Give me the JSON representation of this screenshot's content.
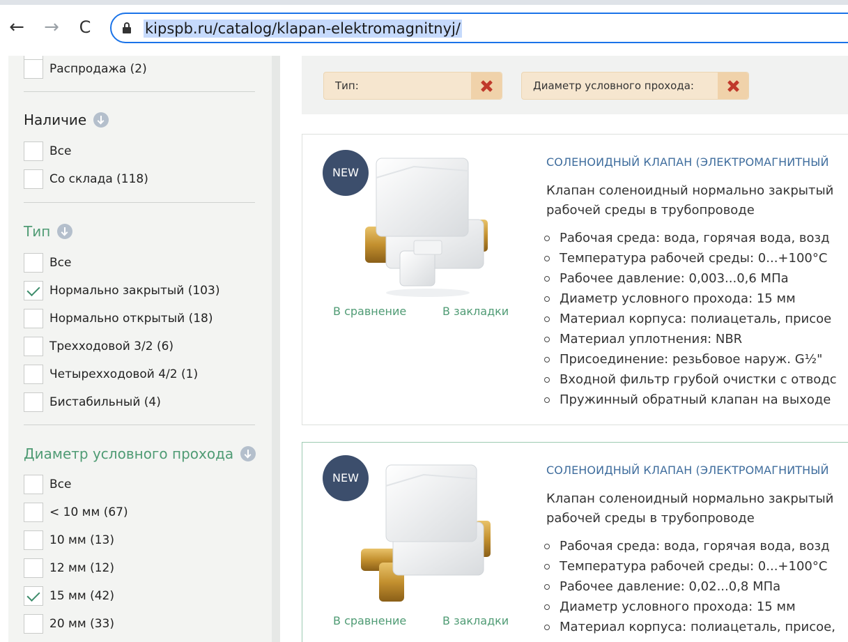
{
  "browser": {
    "url": "kipspb.ru/catalog/klapan-elektromagnitnyj/",
    "back_icon": "←",
    "forward_icon": "→",
    "reload_icon": "C"
  },
  "sidebar": {
    "sale": {
      "label": "Распродажа (2)",
      "checked": false
    },
    "availability": {
      "title": "Наличие",
      "options": [
        {
          "label": "Все",
          "checked": false
        },
        {
          "label": "Со склада (118)",
          "checked": false
        }
      ]
    },
    "type": {
      "title": "Тип",
      "options": [
        {
          "label": "Все",
          "checked": false
        },
        {
          "label": "Нормально закрытый (103)",
          "checked": true
        },
        {
          "label": "Нормально открытый (18)",
          "checked": false
        },
        {
          "label": "Трехходовой 3/2 (6)",
          "checked": false
        },
        {
          "label": "Четырехходовой 4/2 (1)",
          "checked": false
        },
        {
          "label": "Бистабильный (4)",
          "checked": false
        }
      ]
    },
    "diameter": {
      "title": "Диаметр условного прохода",
      "options": [
        {
          "label": "Все",
          "checked": false
        },
        {
          "label": "< 10 мм (67)",
          "checked": false
        },
        {
          "label": "10 мм (13)",
          "checked": false
        },
        {
          "label": "12 мм (12)",
          "checked": false
        },
        {
          "label": "15 мм (42)",
          "checked": true
        },
        {
          "label": "20 мм (33)",
          "checked": false
        }
      ]
    }
  },
  "filters": {
    "chips": [
      {
        "label": "Тип:"
      },
      {
        "label": "Диаметр условного прохода:"
      }
    ]
  },
  "products": [
    {
      "badge": "NEW",
      "compare": "В сравнение",
      "bookmark": "В закладки",
      "title": "СОЛЕНОИДНЫЙ КЛАПАН (ЭЛЕКТРОМАГНИТНЫЙ",
      "desc1": "Клапан соленоидный нормально закрытый",
      "desc2": "рабочей среды в трубопроводе",
      "specs": [
        "Рабочая среда: вода, горячая вода, возд",
        "Температура рабочей среды: 0...+100°C",
        "Рабочее давление: 0,003...0,6 МПа",
        "Диаметр условного прохода: 15 мм",
        "Материал корпуса: полиацеталь, присое",
        "Материал уплотнения: NBR",
        "Присоединение: резьбовое наруж. G½\"",
        "Входной фильтр грубой очистки с отводс",
        "Пружинный обратный клапан на выходе"
      ]
    },
    {
      "badge": "NEW",
      "compare": "В сравнение",
      "bookmark": "В закладки",
      "title": "СОЛЕНОИДНЫЙ КЛАПАН (ЭЛЕКТРОМАГНИТНЫЙ",
      "desc1": "Клапан соленоидный нормально закрытый",
      "desc2": "рабочей среды в трубопроводе",
      "specs": [
        "Рабочая среда: вода, горячая вода, возд",
        "Температура рабочей среды: 0...+100°C",
        "Рабочее давление: 0,02...0,8 МПа",
        "Диаметр условного прохода: 15 мм",
        "Материал корпуса: полиацеталь, присое,"
      ]
    }
  ]
}
